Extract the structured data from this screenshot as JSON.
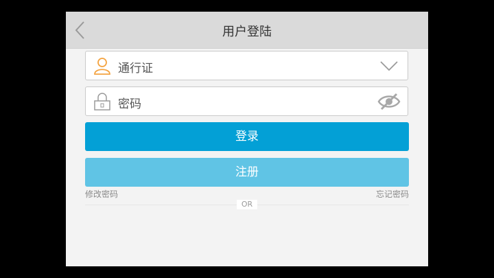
{
  "header": {
    "title": "用户登陆",
    "back_icon": "chevron-left-icon"
  },
  "form": {
    "account": {
      "icon": "user-icon",
      "value": "通行证",
      "dropdown_icon": "chevron-down-icon"
    },
    "password": {
      "icon": "lock-icon",
      "value": "密码",
      "toggle_icon": "eye-off-icon"
    },
    "login_label": "登录",
    "register_label": "注册",
    "change_password": "修改密码",
    "forgot_password": "忘记密码",
    "or_label": "OR"
  },
  "colors": {
    "accent": "#03a0d6",
    "accent_light": "#60c4e5",
    "user_icon": "#f4a340"
  }
}
